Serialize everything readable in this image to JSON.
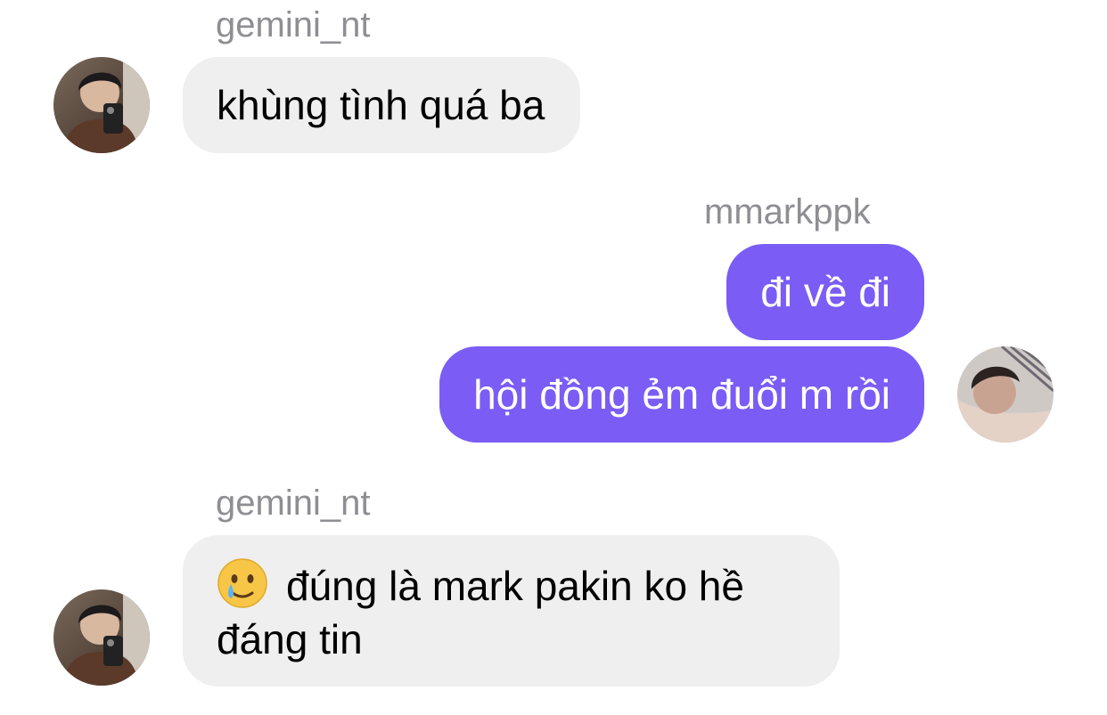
{
  "thread": {
    "messages": [
      {
        "sender": "gemini_nt",
        "direction": "incoming",
        "text": "khùng tình quá ba"
      },
      {
        "sender": "mmarkppk",
        "direction": "outgoing",
        "text": "đi về đi"
      },
      {
        "sender": "mmarkppk",
        "direction": "outgoing",
        "text": "hội đồng ẻm đuổi m rồi"
      },
      {
        "sender": "gemini_nt",
        "direction": "incoming",
        "emoji": "crying-smile-emoji",
        "text": "đúng là mark pakin ko hề đáng tin"
      }
    ]
  },
  "colors": {
    "incoming_bubble": "#efefef",
    "outgoing_bubble": "#7b5cf5",
    "sender_name": "#8e8e93"
  }
}
